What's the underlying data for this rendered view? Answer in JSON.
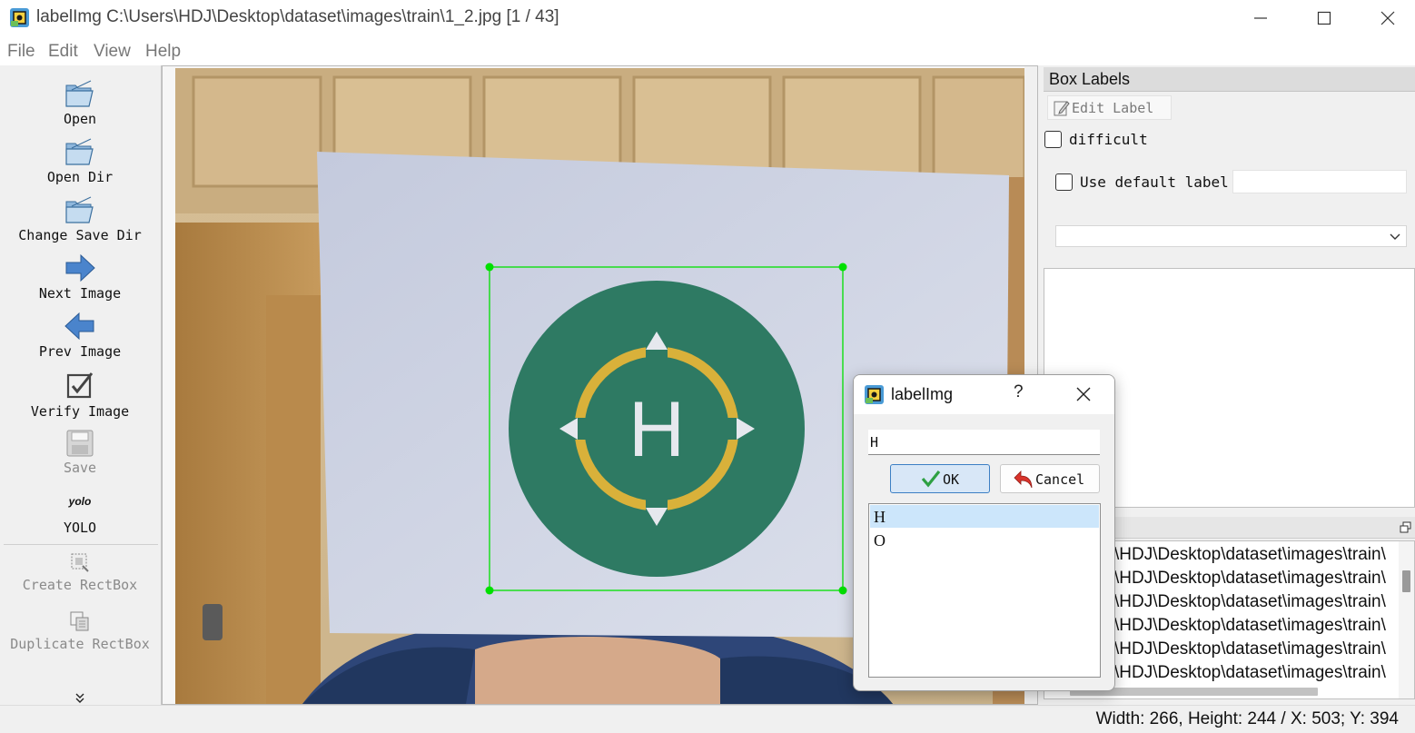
{
  "window": {
    "title": "labelImg C:\\Users\\HDJ\\Desktop\\dataset\\images\\train\\1_2.jpg [1 / 43]",
    "app_icon": "labelimg-app-icon"
  },
  "menu": {
    "items": [
      "File",
      "Edit",
      "View",
      "Help"
    ]
  },
  "toolbar": {
    "items": [
      {
        "label": "Open",
        "icon": "folder-open-icon",
        "enabled": true
      },
      {
        "label": "Open Dir",
        "icon": "folder-open-icon",
        "enabled": true
      },
      {
        "label": "Change Save Dir",
        "icon": "folder-open-icon",
        "enabled": true
      },
      {
        "label": "Next Image",
        "icon": "arrow-right-icon",
        "enabled": true
      },
      {
        "label": "Prev Image",
        "icon": "arrow-left-icon",
        "enabled": true
      },
      {
        "label": "Verify Image",
        "icon": "checkbox-icon",
        "enabled": true
      },
      {
        "label": "Save",
        "icon": "floppy-disk-icon",
        "enabled": false
      },
      {
        "label": "YOLO",
        "icon_text": "yolo",
        "enabled": true
      },
      {
        "label": "Create RectBox",
        "icon": "rectbox-icon",
        "enabled": false
      },
      {
        "label": "Duplicate RectBox",
        "icon": "duplicate-icon",
        "enabled": false
      }
    ],
    "more": "chevron-double-down-icon"
  },
  "canvas": {
    "marker_letter": "H",
    "box_color": "#00e000"
  },
  "box_labels_panel": {
    "title": "Box Labels",
    "edit_label_button": "Edit Label",
    "difficult_label": "difficult",
    "difficult_checked": false,
    "use_default_label": "Use default label",
    "use_default_checked": false,
    "default_label_value": "",
    "combo_value": ""
  },
  "file_list": {
    "rows": [
      "\\HDJ\\Desktop\\dataset\\images\\train\\",
      "\\HDJ\\Desktop\\dataset\\images\\train\\",
      "\\HDJ\\Desktop\\dataset\\images\\train\\",
      "\\HDJ\\Desktop\\dataset\\images\\train\\",
      "\\HDJ\\Desktop\\dataset\\images\\train\\",
      "\\HDJ\\Desktop\\dataset\\images\\train\\"
    ]
  },
  "status": {
    "text": "Width: 266, Height: 244 / X: 503; Y: 394"
  },
  "dialog": {
    "title": "labelImg",
    "help": "?",
    "input_value": "H",
    "ok_label": "OK",
    "cancel_label": "Cancel",
    "labels": [
      "H",
      "O"
    ],
    "selected_index": 0
  },
  "colors": {
    "accent": "#3c7fc4",
    "selection": "#cce6fb",
    "marker_green": "#2e7a63",
    "marker_ring": "#d9b13a"
  }
}
